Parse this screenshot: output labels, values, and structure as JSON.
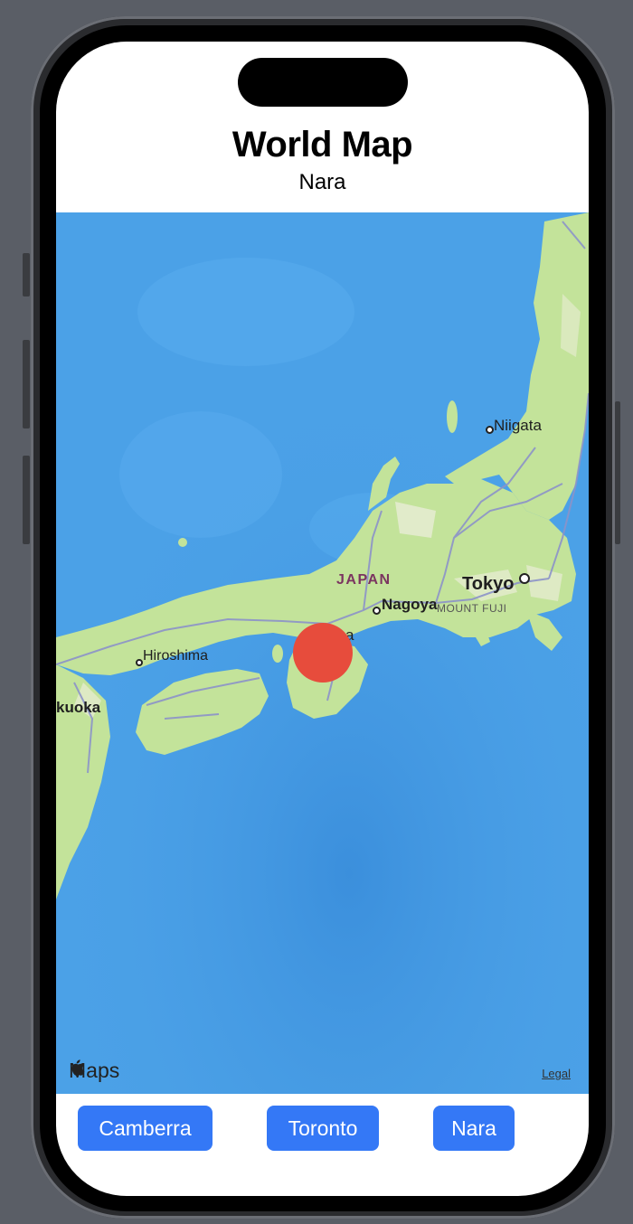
{
  "header": {
    "title": "World Map",
    "subtitle": "Nara"
  },
  "map": {
    "labels": {
      "niigata": "Niigata",
      "japan": "JAPAN",
      "tokyo": "Tokyo",
      "nagoya": "Nagoya",
      "mount_fuji": "MOUNT FUJI",
      "hiroshima": "Hiroshima",
      "fukuoka": "kuoka",
      "osaka_partial": "a"
    },
    "brand": "Maps",
    "legal": "Legal",
    "marker_color": "#e74c3c"
  },
  "buttons": [
    {
      "label": "Camberra"
    },
    {
      "label": "Toronto"
    },
    {
      "label": "Nara"
    }
  ],
  "colors": {
    "accent": "#3478f6",
    "ocean": "#4a9fe6",
    "land": "#b8dc8c"
  }
}
